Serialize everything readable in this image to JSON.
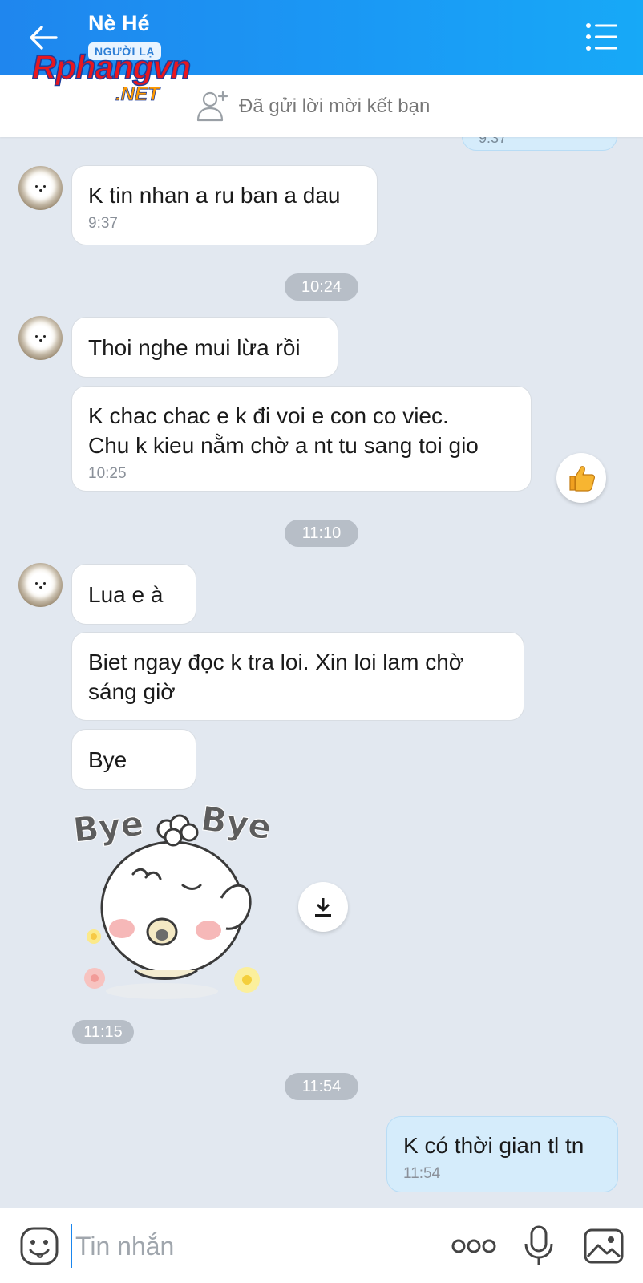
{
  "header": {
    "contact_name": "Nè Hé",
    "badge": "NGƯỜI LẠ"
  },
  "watermark": {
    "main": "Rphangvn",
    "suffix": ".NET"
  },
  "friend_bar": {
    "text": "Đã gửi lời mời kết bạn"
  },
  "partial_message": {
    "time": "9:37"
  },
  "messages": {
    "m1": {
      "text": "K tin nhan a ru ban a dau",
      "time": "9:37"
    },
    "sep1": "10:24",
    "m2": {
      "text": "Thoi nghe mui lừa rồi"
    },
    "m3": {
      "line1": "K chac chac e k đi voi e con co viec.",
      "line2": "Chu k kieu nằm chờ a nt tu sang toi gio",
      "time": "10:25"
    },
    "sep2": "11:10",
    "m4": {
      "text": "Lua e à"
    },
    "m5": {
      "line1": "Biet ngay đọc k tra loi. Xin loi lam chờ",
      "line2": "sáng giờ"
    },
    "m6": {
      "text": "Bye"
    },
    "sticker": {
      "text_left": "Bye",
      "text_right": "Bye",
      "time": "11:15"
    },
    "sep3": "11:54",
    "m7": {
      "text": "K có thời gian tl tn",
      "time": "11:54"
    }
  },
  "composer": {
    "placeholder": "Tin nhắn"
  },
  "icons": {
    "back": "back-arrow-icon",
    "menu": "list-menu-icon",
    "add_friend": "add-friend-icon",
    "like": "thumbs-up-icon",
    "download": "download-icon",
    "emoji": "emoji-icon",
    "more": "more-icon",
    "mic": "microphone-icon",
    "image": "image-icon"
  },
  "colors": {
    "header": "#1a9af5",
    "chat_background": "#e2e8f0",
    "my_bubble": "#d5ecfb",
    "time_pill": "#b7bec7",
    "accent": "#1a86ee"
  }
}
